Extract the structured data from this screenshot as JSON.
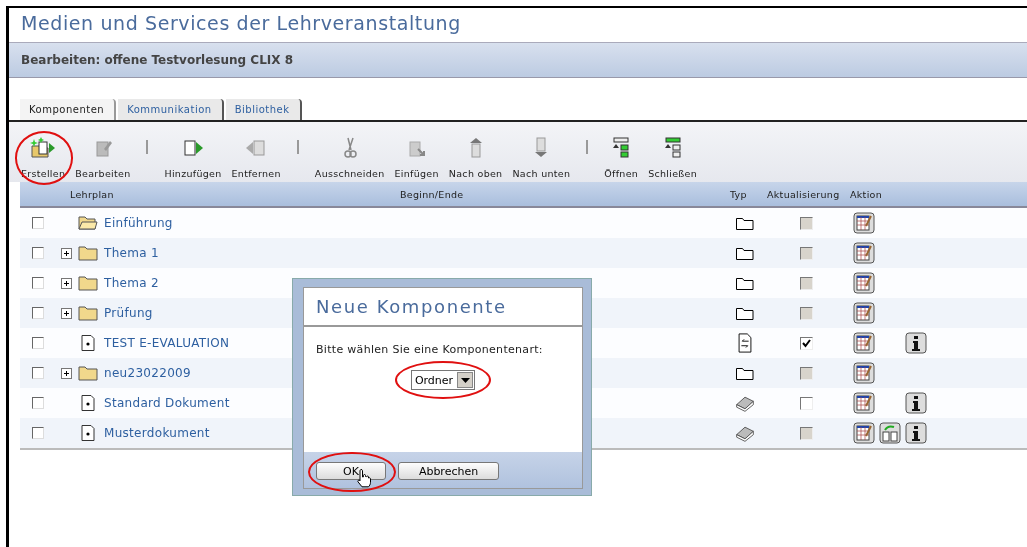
{
  "page_title": "Medien und Services der Lehrveranstaltung",
  "header": "Bearbeiten: offene Testvorlesung CLIX 8",
  "tabs": [
    {
      "label": "Komponenten",
      "selected": true
    },
    {
      "label": "Kommunikation",
      "selected": false
    },
    {
      "label": "Bibliothek",
      "selected": false
    }
  ],
  "toolbar_groups": [
    [
      {
        "label": "Erstellen",
        "kind": "create",
        "highlighted": true
      },
      {
        "label": "Bearbeiten",
        "kind": "edit",
        "highlighted": false
      }
    ],
    [
      {
        "label": "Hinzufügen",
        "kind": "add",
        "highlighted": false
      },
      {
        "label": "Entfernen",
        "kind": "remove",
        "highlighted": false
      }
    ],
    [
      {
        "label": "Ausschneiden",
        "kind": "cut",
        "highlighted": false
      },
      {
        "label": "Einfügen",
        "kind": "paste",
        "highlighted": false
      },
      {
        "label": "Nach oben",
        "kind": "up",
        "highlighted": false
      },
      {
        "label": "Nach unten",
        "kind": "down",
        "highlighted": false
      }
    ],
    [
      {
        "label": "Öffnen",
        "kind": "expand",
        "highlighted": false
      },
      {
        "label": "Schließen",
        "kind": "collapse",
        "highlighted": false
      }
    ]
  ],
  "columns": [
    "Lehrplan",
    "Beginn/Ende",
    "Typ",
    "Aktualisierung",
    "Aktion"
  ],
  "rows": [
    {
      "name": "Einführung",
      "kind": "folder-open",
      "expandable": false,
      "checked": false,
      "type": {
        "kind": "folder"
      },
      "update_checked": false,
      "update_disabled": true,
      "actions": [
        {
          "kind": "edit"
        }
      ]
    },
    {
      "name": "Thema 1",
      "kind": "folder",
      "expandable": true,
      "checked": false,
      "type": {
        "kind": "folder"
      },
      "update_checked": false,
      "update_disabled": true,
      "actions": [
        {
          "kind": "edit"
        }
      ]
    },
    {
      "name": "Thema 2",
      "kind": "folder",
      "expandable": true,
      "checked": false,
      "type": {
        "kind": "folder"
      },
      "update_checked": false,
      "update_disabled": true,
      "actions": [
        {
          "kind": "edit"
        }
      ]
    },
    {
      "name": "Prüfung",
      "kind": "folder",
      "expandable": true,
      "checked": false,
      "type": {
        "kind": "folder"
      },
      "update_checked": false,
      "update_disabled": true,
      "actions": [
        {
          "kind": "edit"
        }
      ]
    },
    {
      "name": "TEST E-EVALUATION",
      "kind": "document",
      "expandable": false,
      "checked": false,
      "type": {
        "kind": "exchange"
      },
      "update_checked": true,
      "update_disabled": false,
      "actions": [
        {
          "kind": "edit"
        },
        {
          "kind": "info"
        }
      ]
    },
    {
      "name": "neu23022009",
      "kind": "folder",
      "expandable": true,
      "checked": false,
      "type": {
        "kind": "folder"
      },
      "update_checked": false,
      "update_disabled": true,
      "actions": [
        {
          "kind": "edit"
        }
      ]
    },
    {
      "name": "Standard Dokument",
      "kind": "document",
      "expandable": false,
      "checked": false,
      "type": {
        "kind": "book"
      },
      "update_checked": false,
      "update_disabled": false,
      "actions": [
        {
          "kind": "edit"
        },
        {
          "kind": "info"
        }
      ]
    },
    {
      "name": "Musterdokument",
      "kind": "document",
      "expandable": false,
      "checked": false,
      "type": {
        "kind": "book"
      },
      "update_checked": false,
      "update_disabled": true,
      "actions": [
        {
          "kind": "edit"
        },
        {
          "kind": "copy"
        },
        {
          "kind": "info"
        }
      ]
    }
  ],
  "dialog": {
    "title": "Neue Komponente",
    "prompt": "Bitte wählen Sie eine Komponentenart:",
    "select": {
      "value": "Ordner",
      "highlighted": true
    },
    "buttons": [
      {
        "label": "OK",
        "highlighted": true
      },
      {
        "label": "Abbrechen",
        "highlighted": false
      }
    ]
  }
}
